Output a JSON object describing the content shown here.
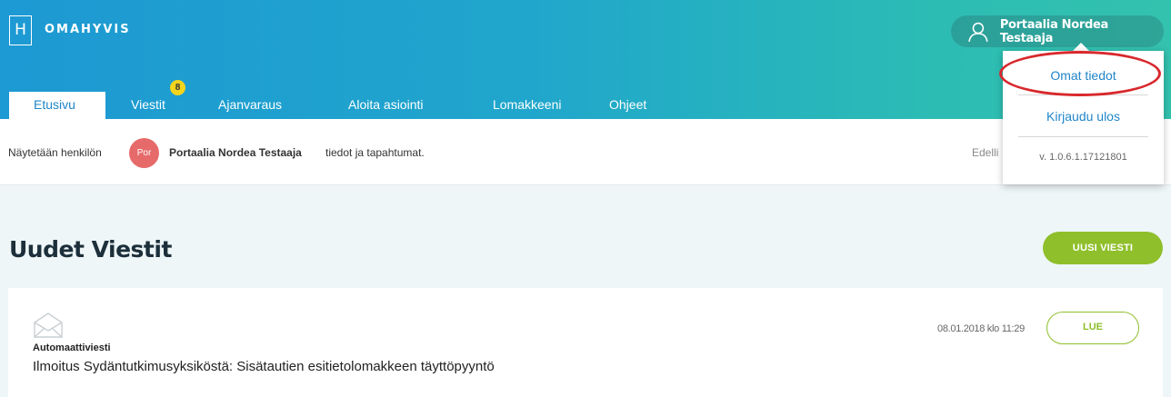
{
  "header": {
    "logo_letter": "H",
    "brand": "OMAHYVIS",
    "user_name": "Portaalia Nordea Testaaja",
    "user_icon": "user-icon"
  },
  "tabs": [
    {
      "label": "Etusivu",
      "active": true
    },
    {
      "label": "Viestit",
      "badge": "8"
    },
    {
      "label": "Ajanvaraus"
    },
    {
      "label": "Aloita asiointi"
    },
    {
      "label": "Lomakkeeni"
    },
    {
      "label": "Ohjeet"
    }
  ],
  "infobar": {
    "prefix": "Näytetään henkilön",
    "avatar_initials": "Por",
    "name": "Portaalia Nordea Testaaja",
    "suffix": "tiedot ja tapahtumat.",
    "previous_truncated": "Edelli"
  },
  "section": {
    "title": "Uudet Viestit",
    "new_button": "UUSI VIESTI"
  },
  "message": {
    "icon": "envelope-open-icon",
    "type": "Automaattiviesti",
    "subject": "Ilmoitus Sydäntutkimusyksiköstä: Sisätautien esitietolomakkeen täyttöpyyntö",
    "date": "08.01.2018 klo 11:29",
    "read_button": "LUE"
  },
  "dropdown": {
    "own_info": "Omat tiedot",
    "logout": "Kirjaudu ulos",
    "version": "v. 1.0.6.1.17121801"
  },
  "colors": {
    "header_start": "#1d99d3",
    "header_end": "#33c2ae",
    "accent_green": "#8fbf2b",
    "link_blue": "#1f86c8",
    "highlight_red": "#d8282c",
    "badge_yellow": "#f2d51c"
  }
}
